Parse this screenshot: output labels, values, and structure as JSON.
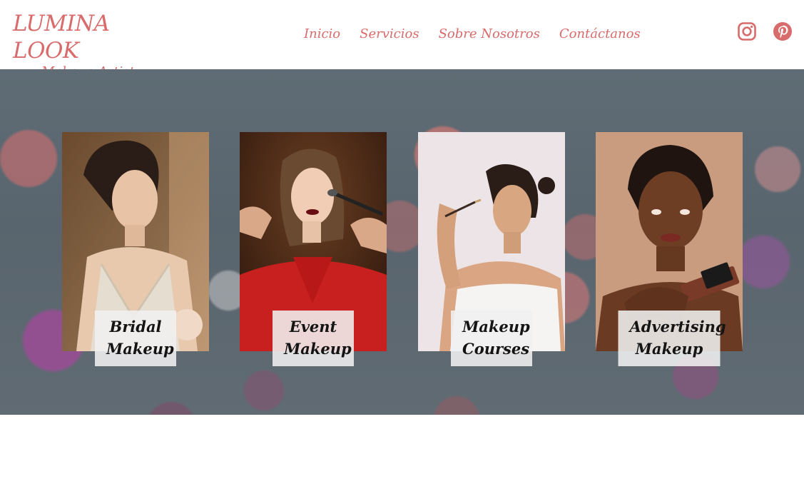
{
  "brand": {
    "name": "LUMINA LOOK",
    "tagline": "Makeup Artist",
    "accent_color": "#d86b6b"
  },
  "nav": {
    "items": [
      {
        "label": "Inicio"
      },
      {
        "label": "Servicios"
      },
      {
        "label": "Sobre Nosotros"
      },
      {
        "label": "Contáctanos"
      }
    ]
  },
  "social": {
    "items": [
      {
        "icon": "instagram-icon"
      },
      {
        "icon": "pinterest-icon"
      }
    ]
  },
  "services": {
    "cards": [
      {
        "line1": "Bridal",
        "line2": "Makeup"
      },
      {
        "line1": "Event",
        "line2": "Makeup"
      },
      {
        "line1": "Makeup",
        "line2": "Courses"
      },
      {
        "line1": "Advertising",
        "line2": "Makeup"
      }
    ]
  }
}
